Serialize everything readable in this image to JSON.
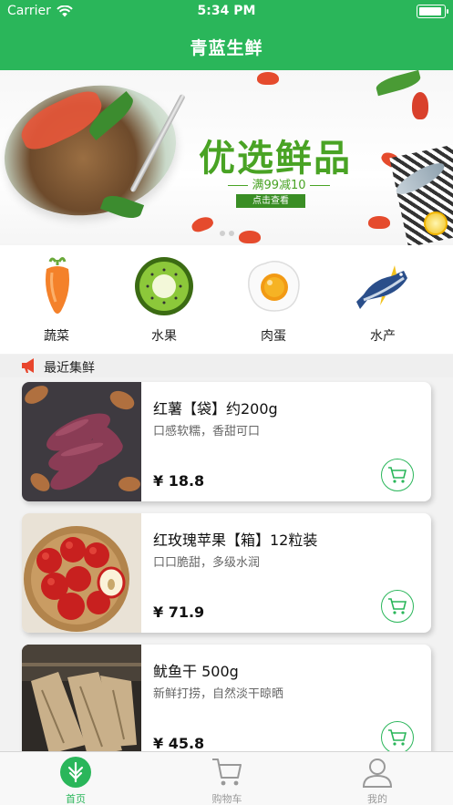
{
  "status_bar": {
    "carrier": "Carrier",
    "time": "5:34 PM"
  },
  "header": {
    "title": "青蓝生鲜"
  },
  "banner": {
    "headline": "优选鲜品",
    "promo": "满99减10",
    "button": "点击查看"
  },
  "categories": [
    {
      "label": "蔬菜",
      "icon": "carrot-icon"
    },
    {
      "label": "水果",
      "icon": "kiwi-icon"
    },
    {
      "label": "肉蛋",
      "icon": "egg-icon"
    },
    {
      "label": "水产",
      "icon": "fish-icon"
    }
  ],
  "section": {
    "title": "最近集鲜",
    "icon": "megaphone-icon"
  },
  "products": [
    {
      "name": "红薯【袋】约200g",
      "desc": "口感软糯，香甜可口",
      "price": "¥ 18.8"
    },
    {
      "name": "红玫瑰苹果【箱】12粒装",
      "desc": "口口脆甜，多级水润",
      "price": "¥ 71.9"
    },
    {
      "name": "鱿鱼干 500g",
      "desc": "新鲜打捞，自然淡干晾晒",
      "price": "¥ 45.8"
    }
  ],
  "tabbar": [
    {
      "label": "首页",
      "active": true
    },
    {
      "label": "购物车",
      "active": false
    },
    {
      "label": "我的",
      "active": false
    }
  ],
  "colors": {
    "brand": "#2ab65a",
    "banner_green": "#49a324"
  }
}
